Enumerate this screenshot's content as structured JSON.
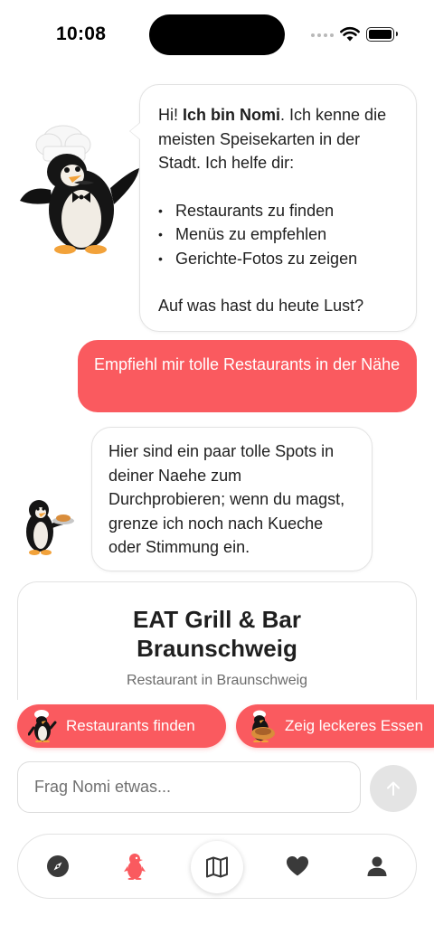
{
  "status_bar": {
    "time": "10:08"
  },
  "chat": {
    "intro": {
      "greeting": "Hi! ",
      "name_bold": "Ich bin Nomi",
      "text": ". Ich kenne die meisten Speisekarten in der Stadt. Ich helfe dir:",
      "bullets": [
        "Restaurants zu finden",
        "Menüs zu empfehlen",
        "Gerichte-Fotos zu zeigen"
      ],
      "outro": "Auf was hast du heute Lust?"
    },
    "user_message": "Empfiehl mir tolle Restaurants in der Nähe",
    "bot_reply": "Hier sind ein paar tolle Spots in deiner Naehe zum Durchprobieren; wenn du magst, grenze ich noch nach Kueche oder Stimmung ein."
  },
  "restaurant_card": {
    "title": "EAT Grill & Bar Braunschweig",
    "subtitle": "Restaurant in Braunschweig"
  },
  "suggestions": [
    {
      "label": "Restaurants finden"
    },
    {
      "label": "Zeig leckeres Essen"
    }
  ],
  "input": {
    "placeholder": "Frag Nomi etwas..."
  },
  "nav": {
    "items": [
      "compass-icon",
      "nomi-penguin-icon",
      "map-icon",
      "heart-icon",
      "person-icon"
    ],
    "active": "nomi-penguin-icon",
    "accent_color": "#fa5a5f"
  },
  "colors": {
    "accent": "#fa5a5f",
    "bubble_border": "#e2e2e2",
    "send_disabled": "#e4e4e4"
  }
}
